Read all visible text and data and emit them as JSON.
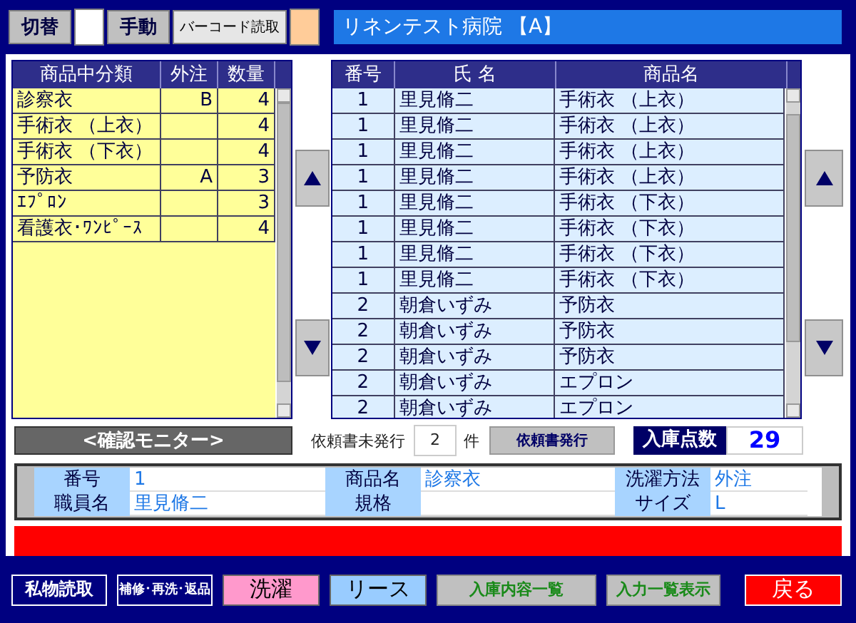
{
  "top_bar": {
    "items": [
      {
        "kind": "button",
        "label": "切替"
      },
      {
        "kind": "swatch",
        "color": "#ffffff"
      },
      {
        "kind": "button",
        "label": "手動"
      },
      {
        "kind": "light",
        "label": "バーコード読取"
      },
      {
        "kind": "swatch",
        "color": "#ffcc99"
      }
    ],
    "title": "リネンテスト病院 【A】"
  },
  "category_table": {
    "columns": [
      "商品中分類",
      "外注",
      "数量"
    ],
    "rows": [
      [
        "診察衣",
        "B",
        "4"
      ],
      [
        "手術衣 （上衣）",
        "",
        "4"
      ],
      [
        "手術衣 （下衣）",
        "",
        "4"
      ],
      [
        "予防衣",
        "A",
        "3"
      ],
      [
        "ｴﾌﾟﾛﾝ",
        "",
        "3"
      ],
      [
        "看護衣･ﾜﾝﾋﾟｰｽ",
        "",
        "4"
      ]
    ]
  },
  "item_table": {
    "columns": [
      "番号",
      "氏 名",
      "商品名"
    ],
    "rows": [
      [
        "1",
        "里見脩二",
        "手術衣 （上衣）"
      ],
      [
        "1",
        "里見脩二",
        "手術衣 （上衣）"
      ],
      [
        "1",
        "里見脩二",
        "手術衣 （上衣）"
      ],
      [
        "1",
        "里見脩二",
        "手術衣 （上衣）"
      ],
      [
        "1",
        "里見脩二",
        "手術衣 （下衣）"
      ],
      [
        "1",
        "里見脩二",
        "手術衣 （下衣）"
      ],
      [
        "1",
        "里見脩二",
        "手術衣 （下衣）"
      ],
      [
        "1",
        "里見脩二",
        "手術衣 （下衣）"
      ],
      [
        "2",
        "朝倉いずみ",
        "予防衣"
      ],
      [
        "2",
        "朝倉いずみ",
        "予防衣"
      ],
      [
        "2",
        "朝倉いずみ",
        "予防衣"
      ],
      [
        "2",
        "朝倉いずみ",
        "エプロン"
      ],
      [
        "2",
        "朝倉いずみ",
        "エプロン"
      ]
    ]
  },
  "monitor_bar": {
    "monitor_label": "<確認モニター>",
    "pending_label": "依頼書未発行",
    "pending_count": "2",
    "pending_unit": "件",
    "issue_button": "依頼書発行",
    "stock_label": "入庫点数",
    "stock_value": "29"
  },
  "detail": {
    "fields": [
      {
        "label": "番号",
        "value": "1"
      },
      {
        "label": "商品名",
        "value": "診察衣"
      },
      {
        "label": "洗濯方法",
        "value": "外注"
      },
      {
        "label": "職員名",
        "value": "里見脩二"
      },
      {
        "label": "規格"
      },
      {
        "label": "サイズ",
        "value": "L"
      }
    ]
  },
  "bottom_buttons": [
    {
      "label": "私物読取",
      "kind": "dark",
      "color": "#000080"
    },
    {
      "label": "補修･再洗･返品",
      "kind": "dark",
      "color": "#000080"
    },
    {
      "label": "洗濯",
      "kind": "light",
      "color": "#ff99cc"
    },
    {
      "label": "リース",
      "kind": "light",
      "color": "#99ccff"
    },
    {
      "label": "入庫内容一覧",
      "kind": "muted",
      "color": "#c0c0c0"
    },
    {
      "label": "入力一覧表示",
      "kind": "muted",
      "color": "#c0c0c0"
    },
    {
      "label": "戻る",
      "kind": "alert",
      "color": "#ff0000"
    }
  ]
}
